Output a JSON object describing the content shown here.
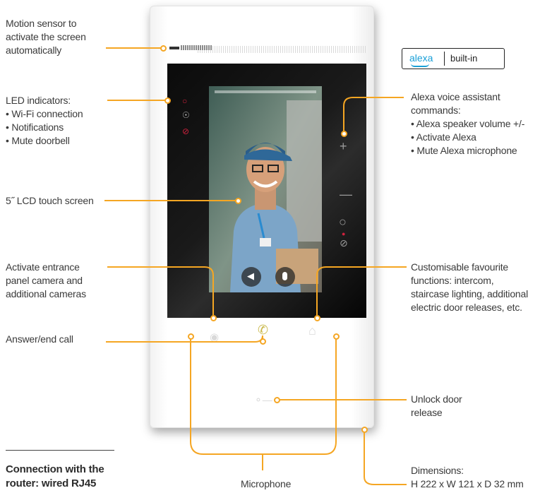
{
  "labels": {
    "motion_sensor": [
      "Motion sensor to",
      "activate the screen",
      "automatically"
    ],
    "led_indicators": [
      "LED indicators:",
      "• Wi-Fi connection",
      "• Notifications",
      "• Mute doorbell"
    ],
    "lcd": "5˝ LCD touch screen",
    "activate_camera": [
      "Activate entrance",
      "panel camera and",
      "additional cameras"
    ],
    "answer_call": "Answer/end call",
    "connection": [
      "Connection with the",
      "router: wired RJ45"
    ],
    "microphone": "Microphone",
    "alexa_commands": [
      "Alexa voice assistant",
      "commands:",
      "• Alexa speaker volume +/-",
      "• Activate Alexa",
      "• Mute Alexa microphone"
    ],
    "favourites": [
      "Customisable favourite",
      "functions: intercom,",
      "staircase lighting, additional",
      "electric door releases, etc."
    ],
    "unlock": [
      "Unlock door",
      "release"
    ],
    "dimensions": [
      "Dimensions:",
      "H 222 x W 121 x D 32 mm"
    ]
  },
  "alexa_badge": {
    "word": "alexa",
    "builtin": "built-in"
  },
  "colors": {
    "callout": "#f5a623",
    "alexa_blue": "#1aa0d8",
    "led_red": "#d0213d"
  },
  "icons": {
    "led": [
      "wifi-icon",
      "notification-icon",
      "mute-doorbell-icon"
    ],
    "touch_keys": [
      "plus-icon",
      "minus-icon",
      "alexa-ring-icon",
      "mic-mute-icon"
    ],
    "front_keys": [
      "camera-key-icon",
      "call-key-icon",
      "home-key-icon",
      "key-icon"
    ]
  }
}
